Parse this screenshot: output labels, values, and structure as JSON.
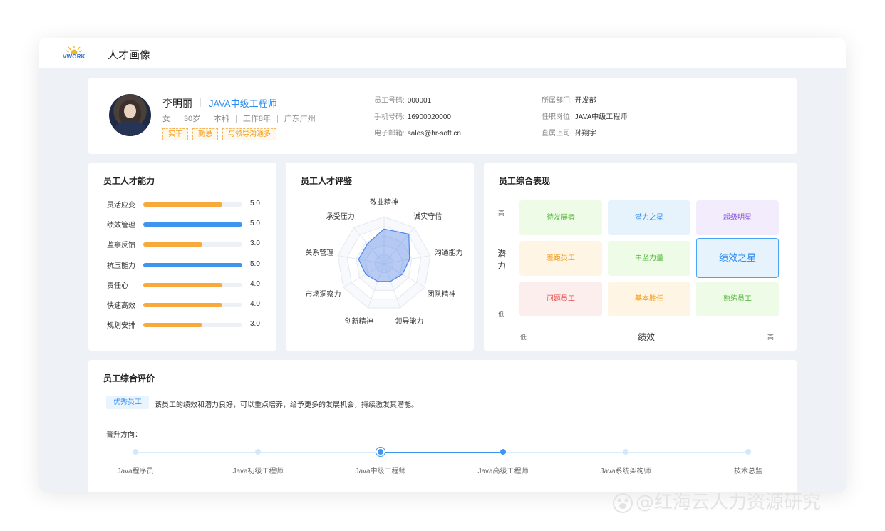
{
  "app": {
    "logo_text": "VWORK",
    "page_title": "人才画像"
  },
  "profile": {
    "name": "李明丽",
    "job_title": "JAVA中级工程师",
    "gender": "女",
    "age": "30岁",
    "education": "本科",
    "experience": "工作8年",
    "location": "广东广州",
    "tags": [
      "实干",
      "勤恳",
      "与领导沟通多"
    ],
    "fields": [
      {
        "label": "员工号码:",
        "value": "000001"
      },
      {
        "label": "手机号码:",
        "value": "16900020000"
      },
      {
        "label": "电子邮箱:",
        "value": "sales@hr-soft.cn"
      },
      {
        "label": "所属部门:",
        "value": "开发部"
      },
      {
        "label": "任职岗位:",
        "value": "JAVA中级工程师"
      },
      {
        "label": "直属上司:",
        "value": "孙翔宇"
      }
    ]
  },
  "skills": {
    "title": "员工人才能力",
    "max": 5,
    "items": [
      {
        "label": "灵活应变",
        "value": "5.0",
        "fill": 0.8,
        "color": "#f8a93b"
      },
      {
        "label": "绩效管理",
        "value": "5.0",
        "fill": 1.0,
        "color": "#3d95f0"
      },
      {
        "label": "监察反馈",
        "value": "3.0",
        "fill": 0.6,
        "color": "#f8a93b"
      },
      {
        "label": "抗压能力",
        "value": "5.0",
        "fill": 1.0,
        "color": "#3d95f0"
      },
      {
        "label": "责任心",
        "value": "4.0",
        "fill": 0.8,
        "color": "#f8a93b"
      },
      {
        "label": "快速高效",
        "value": "4.0",
        "fill": 0.8,
        "color": "#f8a93b"
      },
      {
        "label": "规划安排",
        "value": "3.0",
        "fill": 0.6,
        "color": "#f8a93b"
      }
    ]
  },
  "radar": {
    "title": "员工人才评鉴",
    "axes": [
      "敬业精神",
      "诚实守信",
      "沟通能力",
      "团队精神",
      "领导能力",
      "创新精神",
      "市场洞察力",
      "关系管理",
      "承受压力"
    ],
    "values": [
      0.74,
      0.82,
      0.55,
      0.45,
      0.4,
      0.4,
      0.45,
      0.55,
      0.55
    ]
  },
  "performance": {
    "title": "员工综合表现",
    "y_axis": "潜力",
    "x_axis": "绩效",
    "y_high": "高",
    "y_low": "低",
    "x_low": "低",
    "x_high": "高",
    "cells": [
      {
        "label": "待发展者",
        "bg": "#eefbe6",
        "color": "#52b83a"
      },
      {
        "label": "潜力之星",
        "bg": "#e6f3fd",
        "color": "#2d8cf0"
      },
      {
        "label": "超级明星",
        "bg": "#f2ecfc",
        "color": "#8b5ad8"
      },
      {
        "label": "差距员工",
        "bg": "#fff5e4",
        "color": "#f29b19"
      },
      {
        "label": "中坚力量",
        "bg": "#eefbe6",
        "color": "#52b83a"
      },
      {
        "label": "绩效之星",
        "bg": "#e6f3fd",
        "color": "#2d8cf0"
      },
      {
        "label": "问题员工",
        "bg": "#fdeeee",
        "color": "#ea4b4b"
      },
      {
        "label": "基本胜任",
        "bg": "#fff5e4",
        "color": "#f29b19"
      },
      {
        "label": "熟练员工",
        "bg": "#eefbe6",
        "color": "#52b83a"
      }
    ]
  },
  "evaluation": {
    "title": "员工综合评价",
    "badge": "优秀员工",
    "text": "该员工的绩效和潜力良好，可以重点培养，给予更多的发展机会，持续激发其潜能。",
    "promo_label": "晋升方向：",
    "steps": [
      "Java程序员",
      "Java初级工程师",
      "Java中级工程师",
      "Java高级工程师",
      "Java系统架构师",
      "技术总监"
    ],
    "current_step": 2,
    "next_step": 3
  },
  "watermark": "@红海云人力资源研究"
}
